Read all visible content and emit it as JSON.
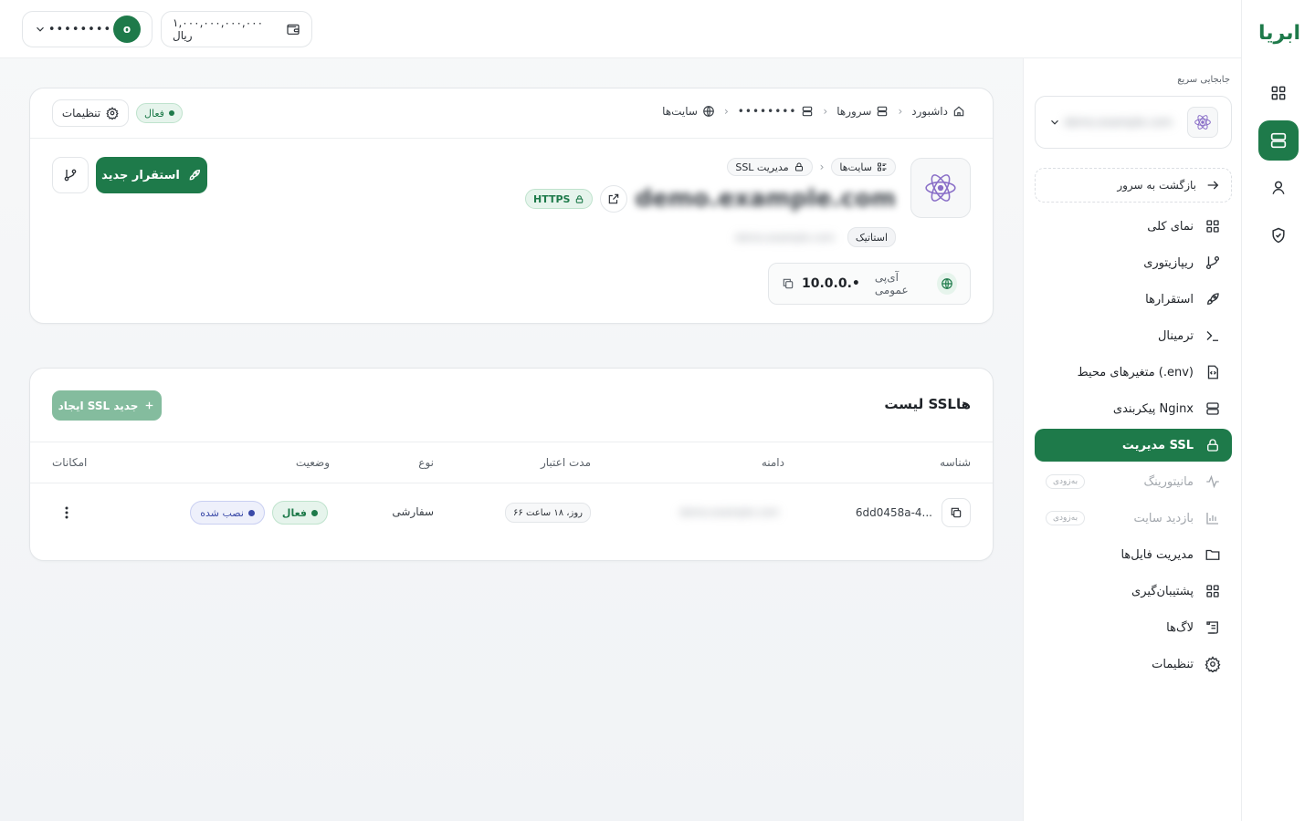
{
  "topbar": {
    "balance": "۱,۰۰۰,۰۰۰,۰۰۰,۰۰۰ ریال",
    "username_masked": "••••••••",
    "avatar_letter": "o"
  },
  "brand": {
    "logo_text": "ابریا",
    "accent": "#1e7a4a"
  },
  "quick_switch": {
    "label": "جابجایی سریع",
    "selected_blurred": "demo.example.com"
  },
  "sidebar": {
    "back_label": "بازگشت به سرور",
    "items": [
      {
        "label": "نمای کلی",
        "icon": "grid-icon"
      },
      {
        "label": "ریپازیتوری",
        "icon": "git-branch-icon"
      },
      {
        "label": "استقرارها",
        "icon": "rocket-icon"
      },
      {
        "label": "ترمینال",
        "icon": "terminal-icon"
      },
      {
        "label": "متغیرهای محیط (.env)",
        "icon": "file-code-icon"
      },
      {
        "label": "پیکربندی Nginx",
        "icon": "server-icon"
      },
      {
        "label": "مدیریت SSL",
        "icon": "lock-icon",
        "active": true
      },
      {
        "label": "مانیتورینگ",
        "icon": "activity-icon",
        "soon": "به‌زودی"
      },
      {
        "label": "بازدید سایت",
        "icon": "bar-chart-icon",
        "soon": "به‌زودی"
      },
      {
        "label": "مدیریت فایل‌ها",
        "icon": "folder-icon"
      },
      {
        "label": "پشتیبان‌گیری",
        "icon": "grid-icon"
      },
      {
        "label": "لاگ‌ها",
        "icon": "scroll-icon"
      },
      {
        "label": "تنظیمات",
        "icon": "gear-icon"
      }
    ]
  },
  "breadcrumb": {
    "dashboard": "داشبورد",
    "servers": "سرورها",
    "server_masked": "••••••••",
    "sites": "سایت‌ها"
  },
  "site": {
    "status": "فعال",
    "settings_label": "تنظیمات",
    "sub_breadcrumb_sites": "سایت‌ها",
    "sub_breadcrumb_current": "مدیریت SSL",
    "domain_blurred": "demo.example.com",
    "https_label": "HTTPS",
    "type_label": "استاتیک",
    "secondary_blurred": "demo.example.com",
    "ip_label": "آی‌پی عمومی",
    "ip_value": "10.0.0.•",
    "deploy_label": "استقرار جدید"
  },
  "ssl": {
    "title": "لیست SSLها",
    "create_label": "ایجاد SSL جدید",
    "columns": [
      "شناسه",
      "دامنه",
      "مدت اعتبار",
      "نوع",
      "وضعیت",
      "امکانات"
    ],
    "rows": [
      {
        "id": "6dd0458a-4...",
        "domain_blurred": "demo.example.com",
        "validity": "۶۶ روز، ۱۸ ساعت",
        "type": "سفارشی",
        "status_active": "فعال",
        "status_installed": "نصب شده"
      }
    ]
  }
}
